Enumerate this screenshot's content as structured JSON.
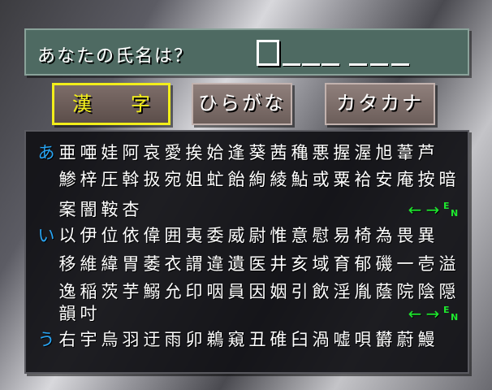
{
  "prompt": {
    "question": "あなたの氏名は？"
  },
  "name_entry": {
    "sei_slots": 3,
    "mei_slots": 3
  },
  "modes": [
    {
      "id": "kanji",
      "label_chars": [
        "漢",
        "字"
      ],
      "selected": true
    },
    {
      "id": "hiragana",
      "label": "ひらがな",
      "selected": false
    },
    {
      "id": "katakana",
      "label": "カタカナ",
      "selected": false
    }
  ],
  "grid": {
    "rows": [
      {
        "head": "あ",
        "chars": "亜唖娃阿哀愛挨姶逢葵茜穐悪握渥旭葦芦"
      },
      {
        "head": "",
        "chars": "鯵梓圧斡扱宛姐虻飴絢綾鮎或粟袷安庵按暗"
      },
      {
        "head": "",
        "chars": "案闇鞍杏",
        "nav": true
      },
      {
        "head": "い",
        "chars": "以伊位依偉囲夷委威尉惟意慰易椅為畏異"
      },
      {
        "head": "",
        "chars": "移維緯胃萎衣謂違遺医井亥域育郁磯一壱溢"
      },
      {
        "head": "",
        "chars": "逸稲茨芋鰯允印咽員因姻引飲淫胤蔭院陰隠"
      },
      {
        "head": "",
        "chars": "韻吋",
        "nav": true
      },
      {
        "head": "う",
        "chars": "右宇烏羽迂雨卯鵜窺丑碓臼渦嘘唄欝蔚鰻"
      }
    ],
    "nav": {
      "prev": "←",
      "next": "→",
      "end_e": "E",
      "end_n": "N"
    },
    "colors": {
      "head": "#29a6f5",
      "nav": "#1ee62e",
      "active_mode": "#f2ee1a"
    }
  }
}
